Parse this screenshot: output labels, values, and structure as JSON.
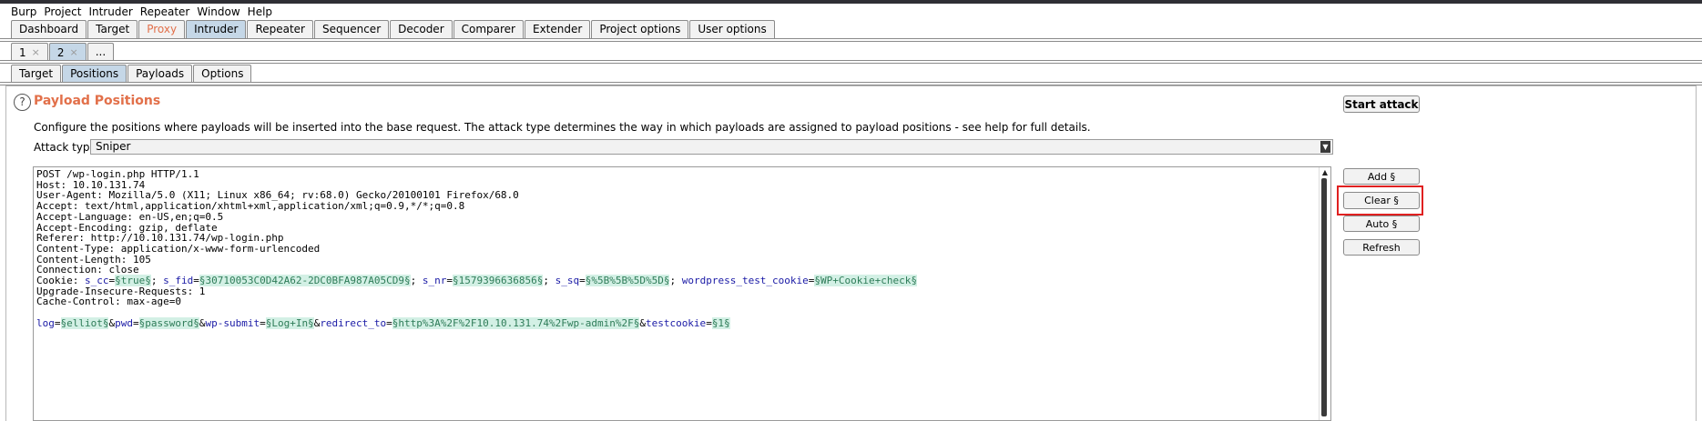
{
  "menubar": {
    "items": [
      "Burp",
      "Project",
      "Intruder",
      "Repeater",
      "Window",
      "Help"
    ]
  },
  "main_tabs": [
    {
      "label": "Dashboard"
    },
    {
      "label": "Target"
    },
    {
      "label": "Proxy"
    },
    {
      "label": "Intruder"
    },
    {
      "label": "Repeater"
    },
    {
      "label": "Sequencer"
    },
    {
      "label": "Decoder"
    },
    {
      "label": "Comparer"
    },
    {
      "label": "Extender"
    },
    {
      "label": "Project options"
    },
    {
      "label": "User options"
    }
  ],
  "attack_tabs": {
    "tab1": "1",
    "tab2": "2",
    "close": "×",
    "more": "..."
  },
  "sub_tabs": [
    "Target",
    "Positions",
    "Payloads",
    "Options"
  ],
  "positions": {
    "help_glyph": "?",
    "title": "Payload Positions",
    "description": "Configure the positions where payloads will be inserted into the base request. The attack type determines the way in which payloads are assigned to payload positions - see help for full details.",
    "attack_type_label": "Attack type:",
    "attack_type_value": "Sniper"
  },
  "buttons": {
    "start_attack": "Start attack",
    "add": "Add §",
    "clear": "Clear §",
    "auto": "Auto §",
    "refresh": "Refresh"
  },
  "request": {
    "line1": "POST /wp-login.php HTTP/1.1",
    "line2": "Host: 10.10.131.74",
    "line3": "User-Agent: Mozilla/5.0 (X11; Linux x86_64; rv:68.0) Gecko/20100101 Firefox/68.0",
    "line4": "Accept: text/html,application/xhtml+xml,application/xml;q=0.9,*/*;q=0.8",
    "line5": "Accept-Language: en-US,en;q=0.5",
    "line6": "Accept-Encoding: gzip, deflate",
    "line7": "Referer: http://10.10.131.74/wp-login.php",
    "line8": "Content-Type: application/x-www-form-urlencoded",
    "line9": "Content-Length: 105",
    "line10": "Connection: close",
    "cookie": {
      "header": "Cookie: ",
      "k1": "s_cc",
      "v1": "§true§",
      "k2": "s_fid",
      "v2": "§30710053C0D42A62-2DC0BFA987A05CD9§",
      "k3": "s_nr",
      "v3": "§1579396636856§",
      "k4": "s_sq",
      "v4": "§%5B%5B%5D%5D§",
      "k5": "wordpress_test_cookie",
      "v5": "§WP+Cookie+check§",
      "eq": "=",
      "sep": "; "
    },
    "line12": "Upgrade-Insecure-Requests: 1",
    "line13": "Cache-Control: max-age=0",
    "body": {
      "k1": "log",
      "v1": "§elliot§",
      "k2": "pwd",
      "v2": "§password§",
      "k3": "wp-submit",
      "v3": "§Log+In§",
      "k4": "redirect_to",
      "v4": "§http%3A%2F%2F10.10.131.74%2Fwp-admin%2F§",
      "k5": "testcookie",
      "v5": "§1§",
      "eq": "=",
      "amp": "&"
    }
  }
}
